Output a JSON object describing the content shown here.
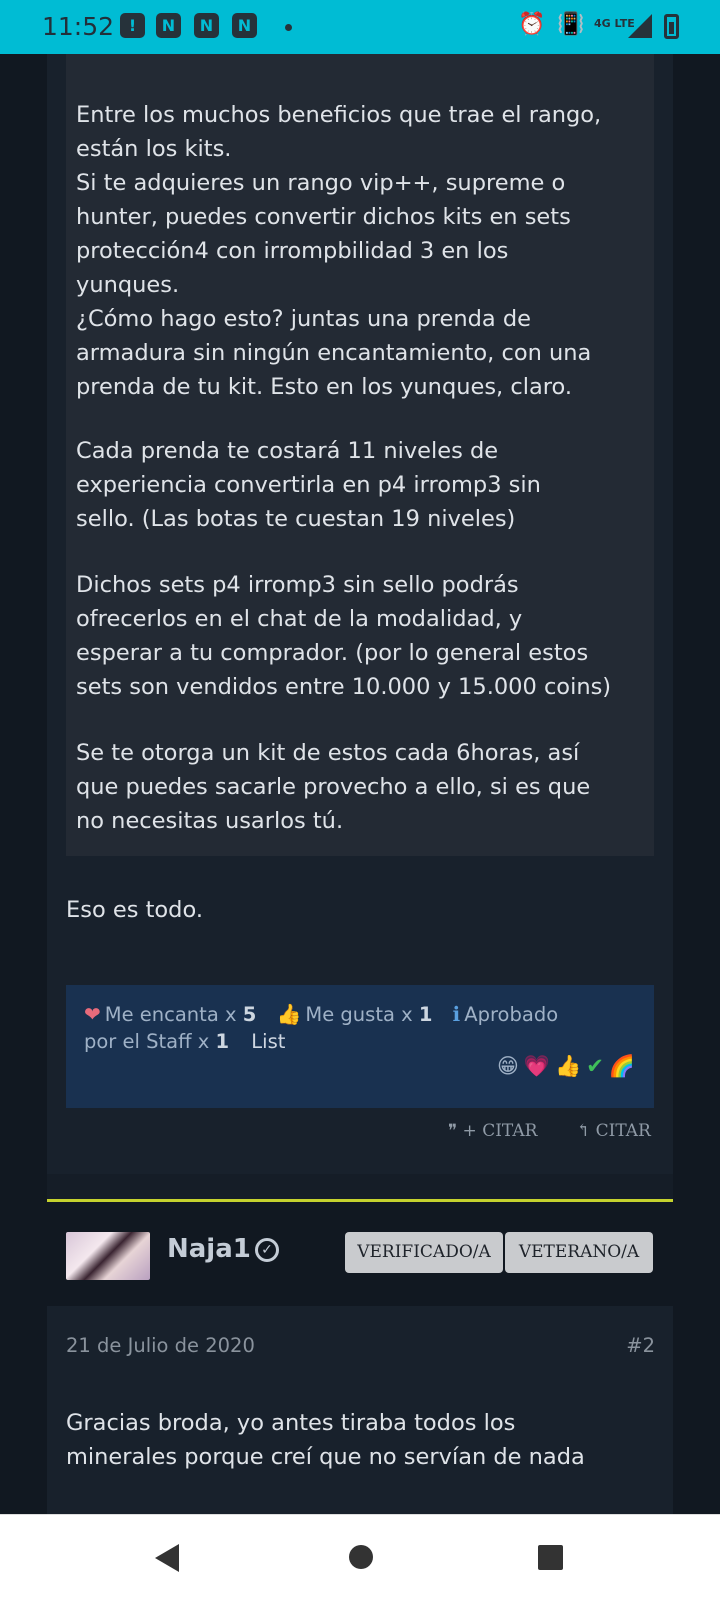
{
  "status_bar": {
    "time": "11:52",
    "icons": [
      "alert-icon",
      "app-icon",
      "app-icon",
      "app-icon"
    ],
    "network": "4G LTE",
    "right_icons": [
      "alarm-icon",
      "vibrate-icon",
      "signal-icon",
      "battery-icon"
    ]
  },
  "quote": {
    "paragraphs": [
      "Entre los muchos beneficios que trae el rango,\nestán los kits.\nSi te adquieres un rango vip++, supreme o\nhunter, puedes convertir dichos kits en sets\nprotección4 con irrompbilidad 3 en los\nyunques.\n¿Cómo hago esto? juntas una prenda de\narmadura sin ningún encantamiento, con una\nprenda de tu kit. Esto en los yunques, claro.",
      "Cada prenda te costará 11 niveles de\nexperiencia convertirla en p4 irromp3 sin\nsello. (Las botas te cuestan 19 niveles)",
      "Dichos sets p4 irromp3 sin sello podrás\nofrecerlos en el chat de la modalidad, y\nesperar a tu comprador. (por lo general estos\nsets son vendidos entre 10.000 y 15.000 coins)",
      "Se te otorga un kit de estos cada 6horas, así\nque puedes sacarle provecho a ello, si es que\nno necesitas usarlos tú."
    ]
  },
  "closing": "Eso es todo.",
  "reactions": {
    "love_label": "Me encanta x",
    "love_count": "5",
    "like_label": "Me gusta x",
    "like_count": "1",
    "approved_label": "Aprobado",
    "approved_label2": "por el Staff x",
    "approved_count": "1",
    "list_label": "List",
    "love_emoji": "❤",
    "like_emoji": "👍",
    "info_emoji": "ℹ",
    "icons": [
      "😁",
      "💗",
      "👍",
      "✔",
      "🌈"
    ]
  },
  "actions": {
    "quote_plus": "❞ + CITAR",
    "quote": "↰ CITAR"
  },
  "post2": {
    "username": "Naja1",
    "badges": [
      "VERIFICADO/A",
      "VETERANO/A"
    ],
    "date": "21 de Julio de 2020",
    "number": "#2",
    "content": "Gracias broda, yo antes tiraba todos los\nminerales porque creí que no servían de nada"
  },
  "colors": {
    "status_bar": "#00bcd4",
    "background": "#151d27",
    "quote_bg": "#232a34",
    "reactions_bg": "#193150",
    "post_divider": "#c5d22e"
  }
}
